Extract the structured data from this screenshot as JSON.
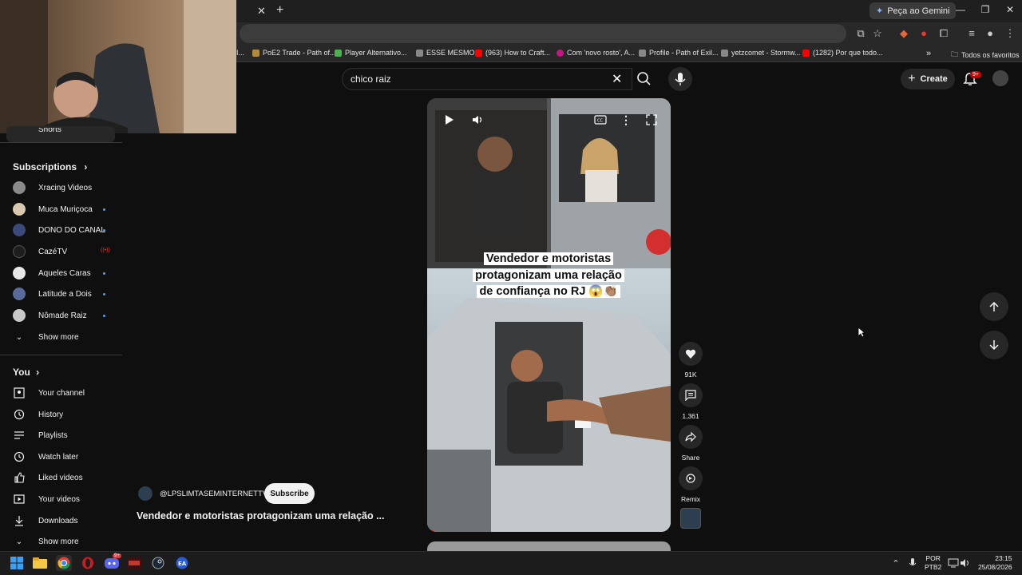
{
  "browser": {
    "gemini_label": "Peça ao Gemini",
    "bookmarks": [
      {
        "label": "I...",
        "color": ""
      },
      {
        "label": "PoE2 Trade - Path of...",
        "color": "#b08a3c"
      },
      {
        "label": "Player Alternativo...",
        "color": "#4caf50"
      },
      {
        "label": "ESSE MESMO",
        "color": "#888888"
      },
      {
        "label": "(963) How to Craft...",
        "color": "#ff0000"
      },
      {
        "label": "Com 'novo rosto', A...",
        "color": "#c71585"
      },
      {
        "label": "Profile - Path of Exil...",
        "color": "#888888"
      },
      {
        "label": "yetzcomet - Stormw...",
        "color": "#888888"
      },
      {
        "label": "(1282) Por que todo...",
        "color": "#ff0000"
      }
    ],
    "bookmarks_overflow": "»",
    "all_bookmarks": "Todos os favoritos"
  },
  "youtube": {
    "search_value": "chico raiz",
    "create_label": "Create",
    "notif_count": "9+",
    "sidebar": {
      "partial_item": "Shorts",
      "subscriptions_title": "Subscriptions",
      "subscriptions": [
        {
          "label": "Xracing Videos",
          "indicator": "",
          "color": "#8a8a8a"
        },
        {
          "label": "Muca Muriçoca",
          "indicator": "dot",
          "color": "#d8c9b0"
        },
        {
          "label": "DONO DO CANAL",
          "indicator": "dot",
          "color": "#3a4a7a"
        },
        {
          "label": "CazéTV",
          "indicator": "live",
          "color": "#1e1e1e"
        },
        {
          "label": "Aqueles Caras",
          "indicator": "dot",
          "color": "#e8e8e8"
        },
        {
          "label": "Latitude a Dois",
          "indicator": "dot",
          "color": "#5a6a9a"
        },
        {
          "label": "Nômade Raiz",
          "indicator": "dot",
          "color": "#c8c8c8"
        }
      ],
      "show_more_1": "Show more",
      "you_title": "You",
      "you_items": [
        {
          "label": "Your channel",
          "icon": "channel-icon"
        },
        {
          "label": "History",
          "icon": "history-icon"
        },
        {
          "label": "Playlists",
          "icon": "playlists-icon"
        },
        {
          "label": "Watch later",
          "icon": "watch-later-icon"
        },
        {
          "label": "Liked videos",
          "icon": "liked-videos-icon"
        },
        {
          "label": "Your videos",
          "icon": "your-videos-icon"
        },
        {
          "label": "Downloads",
          "icon": "downloads-icon"
        }
      ],
      "show_more_2": "Show more"
    },
    "short": {
      "caption_lines": [
        "Vendedor e motoristas",
        "protagonizam uma relação",
        "de confiança no RJ 😱👏🏽"
      ],
      "channel": "@LPSLIMTASEMINTERNETTV",
      "subscribe_label": "Subscribe",
      "title": "Vendedor e motoristas protagonizam uma relação ...",
      "likes": "91K",
      "comments": "1,361",
      "share_label": "Share",
      "remix_label": "Remix"
    }
  },
  "taskbar": {
    "lang_line1": "POR",
    "lang_line2": "PTB2",
    "time": "23:15",
    "date": "25/08/2026",
    "discord_badge": "9+"
  }
}
